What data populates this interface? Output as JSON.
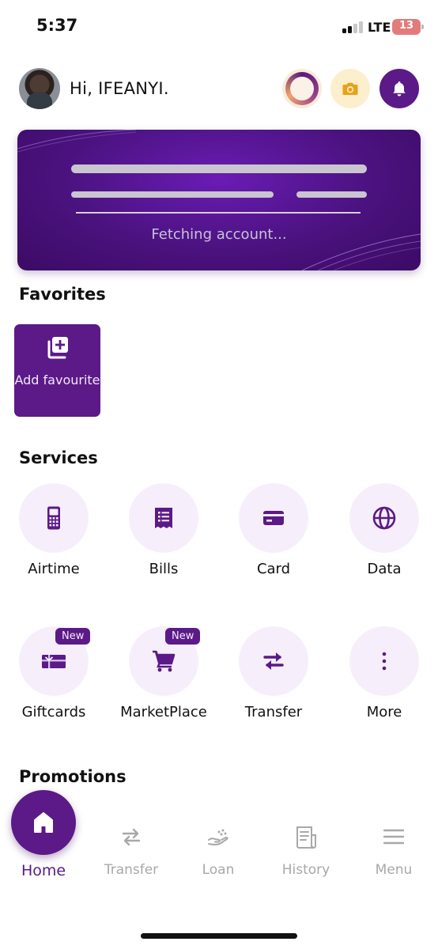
{
  "status_bar": {
    "time": "5:37",
    "network": "LTE",
    "battery": "13"
  },
  "header": {
    "greeting": "Hi, IFEANYI."
  },
  "account_card": {
    "status_text": "Fetching account..."
  },
  "favorites": {
    "title": "Favorites",
    "add_label": "Add favourite"
  },
  "services": {
    "title": "Services",
    "items": [
      {
        "label": "Airtime",
        "icon": "phone-icon"
      },
      {
        "label": "Bills",
        "icon": "receipt-icon"
      },
      {
        "label": "Card",
        "icon": "card-icon"
      },
      {
        "label": "Data",
        "icon": "globe-icon"
      },
      {
        "label": "Giftcards",
        "icon": "giftcard-icon",
        "badge": "New"
      },
      {
        "label": "MarketPlace",
        "icon": "cart-icon",
        "badge": "New"
      },
      {
        "label": "Transfer",
        "icon": "transfer-icon"
      },
      {
        "label": "More",
        "icon": "more-vertical-icon"
      }
    ]
  },
  "promotions": {
    "title": "Promotions"
  },
  "bottom_nav": {
    "items": [
      {
        "label": "Home",
        "active": true
      },
      {
        "label": "Transfer"
      },
      {
        "label": "Loan"
      },
      {
        "label": "History"
      },
      {
        "label": "Menu"
      }
    ]
  },
  "colors": {
    "brand": "#5b1a87",
    "service_circle": "#f6effb",
    "inactive_nav": "#a8a8a8"
  }
}
